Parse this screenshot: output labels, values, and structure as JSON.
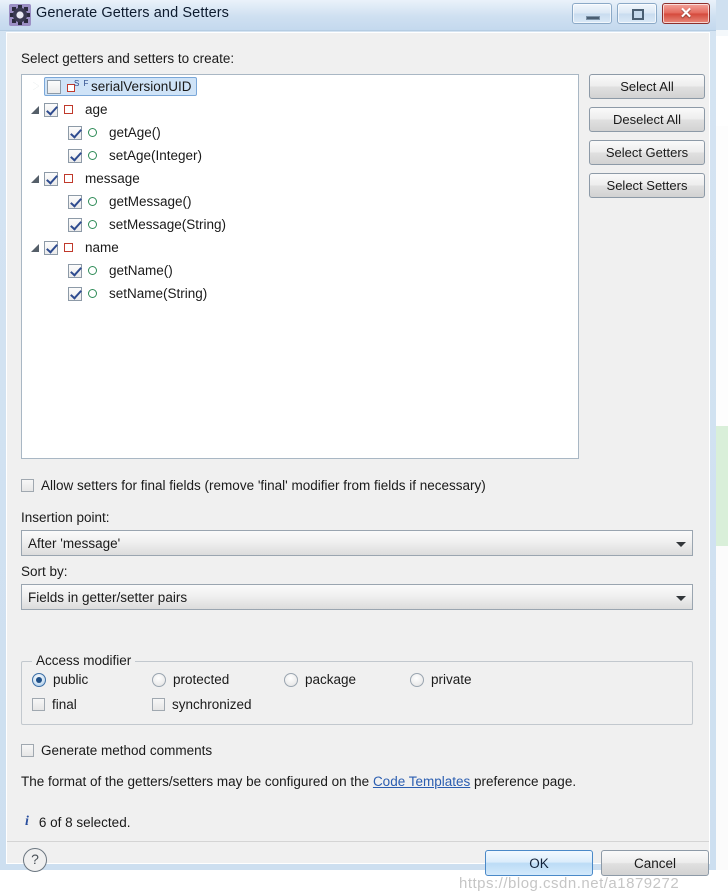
{
  "window": {
    "title": "Generate Getters and Setters",
    "icon": "eclipse-gear-icon",
    "buttons": {
      "minimize": "minimize-icon",
      "maximize": "maximize-icon",
      "close": "✕"
    }
  },
  "main": {
    "top_label": "Select getters and setters to create:",
    "tree": [
      {
        "label": "serialVersionUID",
        "icon": "serial-field-icon",
        "checked": false,
        "twisty": "collapsed",
        "indent": 0,
        "selected": true,
        "badge": "S F"
      },
      {
        "label": "age",
        "icon": "field-icon",
        "checked": true,
        "twisty": "expanded",
        "indent": 0,
        "selected": false
      },
      {
        "label": "getAge()",
        "icon": "method-icon",
        "checked": true,
        "twisty": "none",
        "indent": 1,
        "selected": false
      },
      {
        "label": "setAge(Integer)",
        "icon": "method-icon",
        "checked": true,
        "twisty": "none",
        "indent": 1,
        "selected": false
      },
      {
        "label": "message",
        "icon": "field-icon",
        "checked": true,
        "twisty": "expanded",
        "indent": 0,
        "selected": false
      },
      {
        "label": "getMessage()",
        "icon": "method-icon",
        "checked": true,
        "twisty": "none",
        "indent": 1,
        "selected": false
      },
      {
        "label": "setMessage(String)",
        "icon": "method-icon",
        "checked": true,
        "twisty": "none",
        "indent": 1,
        "selected": false
      },
      {
        "label": "name",
        "icon": "field-icon",
        "checked": true,
        "twisty": "expanded",
        "indent": 0,
        "selected": false
      },
      {
        "label": "getName()",
        "icon": "method-icon",
        "checked": true,
        "twisty": "none",
        "indent": 1,
        "selected": false
      },
      {
        "label": "setName(String)",
        "icon": "method-icon",
        "checked": true,
        "twisty": "none",
        "indent": 1,
        "selected": false
      }
    ],
    "side_buttons": [
      {
        "label": "Select All"
      },
      {
        "label": "Deselect All"
      },
      {
        "label": "Select Getters"
      },
      {
        "label": "Select Setters"
      }
    ],
    "allow_final_setters": {
      "label": "Allow setters for final fields (remove 'final' modifier from fields if necessary)",
      "checked": false
    },
    "insertion_point": {
      "label": "Insertion point:",
      "value": "After 'message'"
    },
    "sort_by": {
      "label": "Sort by:",
      "value": "Fields in getter/setter pairs"
    },
    "access_modifier": {
      "title": "Access modifier",
      "radios": [
        {
          "label": "public",
          "selected": true
        },
        {
          "label": "protected",
          "selected": false
        },
        {
          "label": "package",
          "selected": false
        },
        {
          "label": "private",
          "selected": false
        }
      ],
      "checkboxes": [
        {
          "label": "final",
          "checked": false
        },
        {
          "label": "synchronized",
          "checked": false
        }
      ]
    },
    "generate_comments": {
      "label": "Generate method comments",
      "checked": false
    },
    "format_note": {
      "prefix": "The format of the getters/setters may be configured on the ",
      "link": "Code Templates",
      "suffix": " preference page."
    },
    "status": {
      "icon": "info-icon",
      "text": "6 of 8 selected."
    }
  },
  "footer": {
    "help_label": "?",
    "ok_label": "OK",
    "cancel_label": "Cancel"
  },
  "watermark": "https://blog.csdn.net/a1879272"
}
